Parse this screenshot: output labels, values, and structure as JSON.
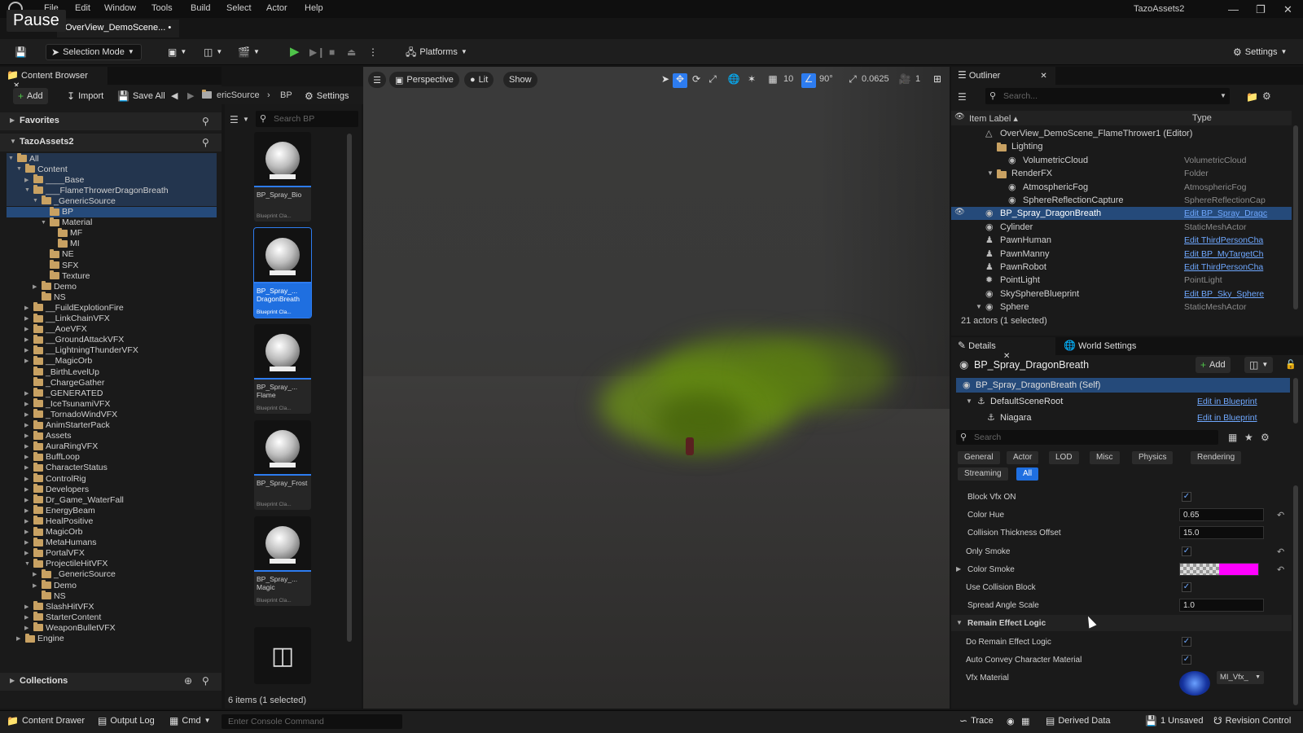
{
  "titlebar": {
    "menu": [
      "File",
      "Edit",
      "Window",
      "Tools",
      "Build",
      "Select",
      "Actor",
      "Help"
    ],
    "pause_tooltip": "Pause",
    "project_name": "TazoAssets2",
    "level_tab": "OverView_DemoScene... •"
  },
  "toolbar": {
    "selection_mode": "Selection Mode",
    "platforms": "Platforms",
    "settings": "Settings"
  },
  "content_browser": {
    "tab": "Content Browser",
    "add": "Add",
    "import": "Import",
    "save_all": "Save All",
    "path": [
      "ericSource",
      "BP"
    ],
    "settings": "Settings",
    "favorites": "Favorites",
    "project": "TazoAssets2",
    "collections": "Collections",
    "search_placeholder": "Search BP",
    "tree": [
      {
        "label": "All",
        "d": 0,
        "open": true
      },
      {
        "label": "Content",
        "d": 1,
        "open": true
      },
      {
        "label": "____Base",
        "d": 2,
        "open": false
      },
      {
        "label": "___FlameThrowerDragonBreath",
        "d": 2,
        "open": true
      },
      {
        "label": "_GenericSource",
        "d": 3,
        "open": true
      },
      {
        "label": "BP",
        "d": 4,
        "sel": true
      },
      {
        "label": "Material",
        "d": 4,
        "open": true
      },
      {
        "label": "MF",
        "d": 5
      },
      {
        "label": "MI",
        "d": 5
      },
      {
        "label": "NE",
        "d": 4
      },
      {
        "label": "SFX",
        "d": 4
      },
      {
        "label": "Texture",
        "d": 4
      },
      {
        "label": "Demo",
        "d": 3,
        "open": false
      },
      {
        "label": "NS",
        "d": 3
      },
      {
        "label": "__FuildExplotionFire",
        "d": 2,
        "open": false
      },
      {
        "label": "__LinkChainVFX",
        "d": 2,
        "open": false
      },
      {
        "label": "__AoeVFX",
        "d": 2,
        "open": false
      },
      {
        "label": "__GroundAttackVFX",
        "d": 2,
        "open": false
      },
      {
        "label": "__LightningThunderVFX",
        "d": 2,
        "open": false
      },
      {
        "label": "__MagicOrb",
        "d": 2,
        "open": false
      },
      {
        "label": "_BirthLevelUp",
        "d": 2
      },
      {
        "label": "_ChargeGather",
        "d": 2
      },
      {
        "label": "_GENERATED",
        "d": 2,
        "open": false
      },
      {
        "label": "_IceTsunamiVFX",
        "d": 2,
        "open": false
      },
      {
        "label": "_TornadoWindVFX",
        "d": 2,
        "open": false
      },
      {
        "label": "AnimStarterPack",
        "d": 2,
        "open": false
      },
      {
        "label": "Assets",
        "d": 2,
        "open": false
      },
      {
        "label": "AuraRingVFX",
        "d": 2,
        "open": false
      },
      {
        "label": "BuffLoop",
        "d": 2,
        "open": false
      },
      {
        "label": "CharacterStatus",
        "d": 2,
        "open": false
      },
      {
        "label": "ControlRig",
        "d": 2,
        "open": false
      },
      {
        "label": "Developers",
        "d": 2,
        "open": false
      },
      {
        "label": "Dr_Game_WaterFall",
        "d": 2,
        "open": false
      },
      {
        "label": "EnergyBeam",
        "d": 2,
        "open": false
      },
      {
        "label": "HealPositive",
        "d": 2,
        "open": false
      },
      {
        "label": "MagicOrb",
        "d": 2,
        "open": false
      },
      {
        "label": "MetaHumans",
        "d": 2,
        "open": false
      },
      {
        "label": "PortalVFX",
        "d": 2,
        "open": false
      },
      {
        "label": "ProjectileHitVFX",
        "d": 2,
        "open": true
      },
      {
        "label": "_GenericSource",
        "d": 3,
        "open": false
      },
      {
        "label": "Demo",
        "d": 3,
        "open": false
      },
      {
        "label": "NS",
        "d": 3
      },
      {
        "label": "SlashHitVFX",
        "d": 2,
        "open": false
      },
      {
        "label": "StarterContent",
        "d": 2,
        "open": false
      },
      {
        "label": "WeaponBulletVFX",
        "d": 2,
        "open": false
      },
      {
        "label": "Engine",
        "d": 1,
        "open": false
      }
    ],
    "assets": [
      {
        "name": "BP_Spray_Bio",
        "type": "Blueprint Cla..."
      },
      {
        "name": "BP_Spray_... DragonBreath",
        "type": "Blueprint Cla...",
        "sel": true
      },
      {
        "name": "BP_Spray_... Flame",
        "type": "Blueprint Cla..."
      },
      {
        "name": "BP_Spray_Frost",
        "type": "Blueprint Cla..."
      },
      {
        "name": "BP_Spray_... Magic",
        "type": "Blueprint Cla..."
      }
    ],
    "item_count": "6 items (1 selected)"
  },
  "viewport": {
    "perspective": "Perspective",
    "lit": "Lit",
    "show": "Show",
    "grid_snap": "10",
    "angle_snap": "90°",
    "scale_snap": "0.0625",
    "camera_speed": "1"
  },
  "outliner": {
    "tab": "Outliner",
    "search_placeholder": "Search...",
    "col_label": "Item Label ▴",
    "col_type": "Type",
    "rows": [
      {
        "label": "OverView_DemoScene_FlameThrower1 (Editor)",
        "type": "",
        "d": 0,
        "kind": "level"
      },
      {
        "label": "Lighting",
        "type": "",
        "d": 1,
        "kind": "folder"
      },
      {
        "label": "VolumetricCloud",
        "type": "VolumetricCloud",
        "d": 2,
        "kind": "actor"
      },
      {
        "label": "RenderFX",
        "type": "Folder",
        "d": 1,
        "kind": "folder",
        "open": true
      },
      {
        "label": "AtmosphericFog",
        "type": "AtmosphericFog",
        "d": 2,
        "kind": "actor"
      },
      {
        "label": "SphereReflectionCapture",
        "type": "SphereReflectionCap",
        "d": 2,
        "kind": "actor"
      },
      {
        "label": "BP_Spray_DragonBreath",
        "type": "Edit BP_Spray_Dragc",
        "d": 0,
        "kind": "actor",
        "link": true,
        "sel": true
      },
      {
        "label": "Cylinder",
        "type": "StaticMeshActor",
        "d": 0,
        "kind": "actor"
      },
      {
        "label": "PawnHuman",
        "type": "Edit ThirdPersonCha",
        "d": 0,
        "kind": "pawn",
        "link": true
      },
      {
        "label": "PawnManny",
        "type": "Edit BP_MyTargetCh",
        "d": 0,
        "kind": "pawn",
        "link": true
      },
      {
        "label": "PawnRobot",
        "type": "Edit ThirdPersonCha",
        "d": 0,
        "kind": "pawn",
        "link": true
      },
      {
        "label": "PointLight",
        "type": "PointLight",
        "d": 0,
        "kind": "light"
      },
      {
        "label": "SkySphereBlueprint",
        "type": "Edit BP_Sky_Sphere",
        "d": 0,
        "kind": "actor",
        "link": true
      },
      {
        "label": "Sphere",
        "type": "StaticMeshActor",
        "d": 0,
        "kind": "actor",
        "open": true
      }
    ],
    "actor_count": "21 actors (1 selected)"
  },
  "details": {
    "tab": "Details",
    "world_settings_tab": "World Settings",
    "actor_name": "BP_Spray_DragonBreath",
    "add": "Add",
    "components": [
      {
        "label": "BP_Spray_DragonBreath (Self)",
        "link": ""
      },
      {
        "label": "DefaultSceneRoot",
        "link": "Edit in Blueprint"
      },
      {
        "label": "Niagara",
        "link": "Edit in Blueprint"
      }
    ],
    "search_placeholder": "Search",
    "filters": [
      "General",
      "Actor",
      "LOD",
      "Misc",
      "Physics",
      "Rendering",
      "Streaming",
      "All"
    ],
    "props": [
      {
        "label": "Block Vfx ON",
        "kind": "check"
      },
      {
        "label": "Color Hue",
        "kind": "num",
        "value": "0.65",
        "reset": true
      },
      {
        "label": "Collision Thickness Offset",
        "kind": "num",
        "value": "15.0"
      },
      {
        "label": "Only Smoke",
        "kind": "check",
        "reset": true
      },
      {
        "label": "Color Smoke",
        "kind": "color",
        "reset": true,
        "color": "#ff00ff"
      },
      {
        "label": "Use Collision Block",
        "kind": "check"
      },
      {
        "label": "Spread Angle Scale",
        "kind": "num",
        "value": "1.0"
      },
      {
        "label": "Remain Effect Logic",
        "kind": "header"
      },
      {
        "label": "Do Remain Effect Logic",
        "kind": "check"
      },
      {
        "label": "Auto Convey Character Material",
        "kind": "check"
      },
      {
        "label": "Vfx Material",
        "kind": "material",
        "value": "MI_Vfx_"
      }
    ]
  },
  "statusbar": {
    "content_drawer": "Content Drawer",
    "output_log": "Output Log",
    "cmd": "Cmd",
    "console_placeholder": "Enter Console Command",
    "trace": "Trace",
    "derived_data": "Derived Data",
    "unsaved": "1 Unsaved",
    "revision_control": "Revision Control"
  },
  "colors": {
    "accent": "#2d7cf0",
    "link": "#6fa8ff",
    "selection": "#254a7a",
    "folder": "#c8a162",
    "play": "#4fc34a"
  }
}
